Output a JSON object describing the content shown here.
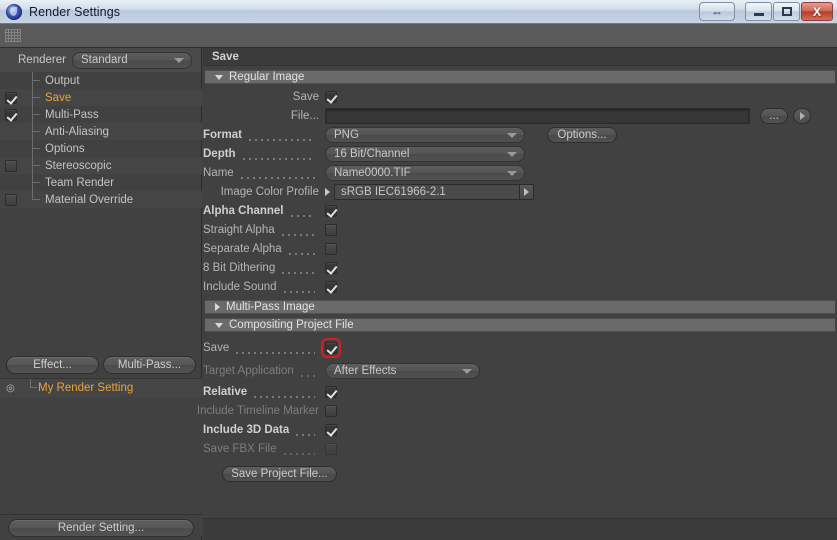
{
  "window": {
    "title": "Render Settings",
    "icon": "c4d-logo-icon",
    "buttons": {
      "resize": "⇔",
      "minimize": "minimize-icon",
      "maximize": "maximize-icon",
      "close": "X"
    }
  },
  "sidebar": {
    "renderer_label": "Renderer",
    "renderer_value": "Standard",
    "tree": [
      {
        "label": "Output",
        "checkbox": "none",
        "selected": false
      },
      {
        "label": "Save",
        "checkbox": "checked",
        "selected": true
      },
      {
        "label": "Multi-Pass",
        "checkbox": "checked",
        "selected": false
      },
      {
        "label": "Anti-Aliasing",
        "checkbox": "none",
        "selected": false
      },
      {
        "label": "Options",
        "checkbox": "none",
        "selected": false
      },
      {
        "label": "Stereoscopic",
        "checkbox": "unchecked",
        "selected": false
      },
      {
        "label": "Team Render",
        "checkbox": "none",
        "selected": false
      },
      {
        "label": "Material Override",
        "checkbox": "unchecked",
        "selected": false
      }
    ],
    "effect_button": "Effect...",
    "multipass_button": "Multi-Pass...",
    "render_setting_item": "My Render Setting",
    "render_setting_button": "Render Setting..."
  },
  "main": {
    "panel_title": "Save",
    "sections": {
      "regular_image": {
        "title": "Regular Image",
        "expanded": true,
        "save_label": "Save",
        "save_checked": true,
        "file_label": "File...",
        "file_value": "",
        "file_browse": "...",
        "format_label": "Format",
        "format_value": "PNG",
        "options_button": "Options...",
        "depth_label": "Depth",
        "depth_value": "16 Bit/Channel",
        "name_label": "Name",
        "name_value": "Name0000.TIF",
        "profile_label": "Image Color Profile",
        "profile_value": "sRGB IEC61966-2.1",
        "checks": [
          {
            "label": "Alpha Channel",
            "state": "checked",
            "bold": true,
            "disabled": false
          },
          {
            "label": "Straight Alpha",
            "state": "unchecked",
            "bold": false,
            "disabled": false
          },
          {
            "label": "Separate Alpha",
            "state": "unchecked",
            "bold": false,
            "disabled": false
          },
          {
            "label": "8 Bit Dithering",
            "state": "checked",
            "bold": false,
            "disabled": false
          },
          {
            "label": "Include Sound",
            "state": "checked",
            "bold": false,
            "disabled": false
          }
        ]
      },
      "multi_pass_image": {
        "title": "Multi-Pass Image",
        "expanded": false
      },
      "compositing_project_file": {
        "title": "Compositing Project File",
        "expanded": true,
        "save_label": "Save",
        "save_checked": true,
        "save_highlighted": true,
        "target_label": "Target Application",
        "target_value": "After Effects",
        "checks": [
          {
            "label": "Relative",
            "state": "checked",
            "bold": true,
            "disabled": false
          },
          {
            "label": "Include Timeline Marker",
            "state": "unchecked",
            "bold": false,
            "disabled": false
          },
          {
            "label": "Include 3D Data",
            "state": "checked",
            "bold": true,
            "disabled": false
          },
          {
            "label": "Save FBX File",
            "state": "unchecked",
            "bold": false,
            "disabled": true
          }
        ],
        "save_project_button": "Save Project File..."
      }
    }
  },
  "colors": {
    "accent_orange": "#e8a33d",
    "highlight_red": "#e01b1b",
    "panel_bg": "#414141",
    "section_header": "#6a6a6a"
  }
}
